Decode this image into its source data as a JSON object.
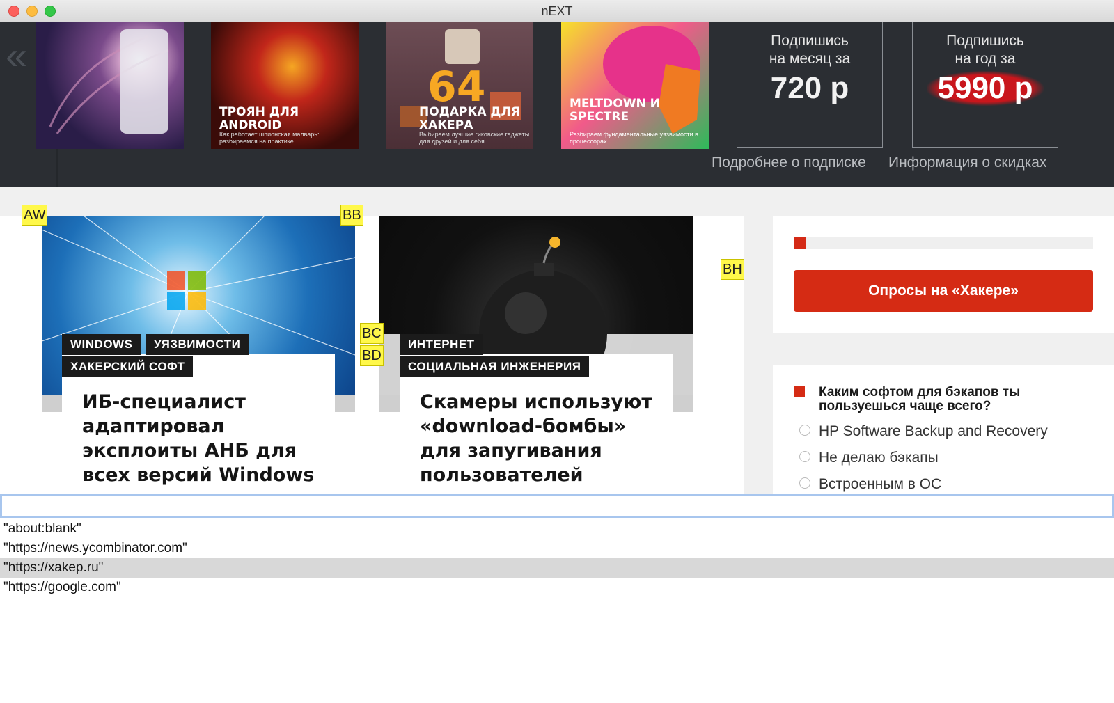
{
  "window": {
    "title": "nEXT"
  },
  "magazines": [
    {
      "title": "",
      "subtitle": ""
    },
    {
      "title": "ТРОЯН ДЛЯ ANDROID",
      "subtitle": "Как работает шпионская малварь: разбираемся на практике"
    },
    {
      "title": "ПОДАРКА ДЛЯ ХАКЕРА",
      "number": "64",
      "subtitle": "Выбираем лучшие гиковские гаджеты для друзей и для себя"
    },
    {
      "title": "MELTDOWN И SPECTRE",
      "subtitle": "Разбираем фундаментальные уязвимости в процессорах"
    }
  ],
  "subscription": {
    "month": {
      "line1": "Подпишись",
      "line2": "на месяц за",
      "price": "720 р"
    },
    "year": {
      "line1": "Подпишись",
      "line2": "на год за",
      "price": "5990 р"
    },
    "link_details": "Подробнее о подписке",
    "link_discounts": "Информация о скидках"
  },
  "hints": {
    "aw": "AW",
    "bb": "BB",
    "bc": "BC",
    "bd": "BD",
    "bh": "BH"
  },
  "articles": [
    {
      "tags": [
        "WINDOWS",
        "УЯЗВИМОСТИ",
        "ХАКЕРСКИЙ СОФТ"
      ],
      "headline": "ИБ-специалист адаптировал эксплоиты АНБ для всех версий Windows"
    },
    {
      "tags": [
        "ИНТЕРНЕТ",
        "СОЦИАЛЬНАЯ ИНЖЕНЕРИЯ"
      ],
      "headline": "Скамеры используют «download-бомбы» для запугивания пользователей"
    }
  ],
  "polls": {
    "progress": 0.04,
    "button_label": "Опросы на «Хакере»",
    "question": "Каким софтом для бэкапов ты пользуешься чаще всего?",
    "options": [
      "HP Software Backup and Recovery",
      "Не делаю бэкапы",
      "Встроенным в ОС"
    ]
  },
  "urlbar": {
    "value": "",
    "suggestions": [
      "\"about:blank\"",
      "\"https://news.ycombinator.com\"",
      "\"https://xakep.ru\"",
      "\"https://google.com\""
    ],
    "selected_index": 2
  },
  "colors": {
    "accent_red": "#d52b14",
    "strip_bg": "#2b2e33",
    "hint_yellow": "#fff84a",
    "url_focus": "#a8c6ee"
  }
}
